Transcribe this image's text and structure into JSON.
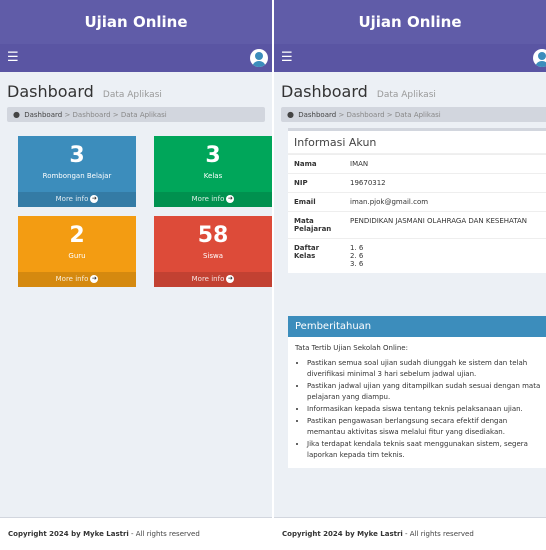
{
  "app": {
    "title": "Ujian Online"
  },
  "header": {
    "menu_icon": "hamburger-icon",
    "avatar_icon": "user-circle-icon"
  },
  "page": {
    "title": "Dashboard",
    "subtitle": "Data Aplikasi"
  },
  "breadcrumb": {
    "home_icon": "dashboard-icon",
    "items": [
      "Dashboard",
      "Dashboard",
      "Data Aplikasi"
    ],
    "separator": ">"
  },
  "stats": [
    {
      "value": "3",
      "label": "Rombongan Belajar",
      "more": "More info",
      "color": "#3c8dbc"
    },
    {
      "value": "3",
      "label": "Kelas",
      "more": "More info",
      "color": "#00a65a"
    },
    {
      "value": "2",
      "label": "Guru",
      "more": "More info",
      "color": "#f39c12"
    },
    {
      "value": "58",
      "label": "Siswa",
      "more": "More info",
      "color": "#dd4b39"
    }
  ],
  "account": {
    "title": "Informasi Akun",
    "rows": [
      {
        "label": "Nama",
        "value": "IMAN"
      },
      {
        "label": "NIP",
        "value": "19670312"
      },
      {
        "label": "Email",
        "value": "iman.pjok@gmail.com"
      },
      {
        "label": "Mata Pelajaran",
        "value": "PENDIDIKAN JASMANI OLAHRAGA DAN KESEHATAN"
      },
      {
        "label": "Daftar Kelas",
        "value": "1. 6\n2. 6\n3. 6"
      }
    ]
  },
  "notice": {
    "title": "Pemberitahuan",
    "intro": "Tata Tertib Ujian Sekolah Online:",
    "items": [
      "Pastikan semua soal ujian sudah diunggah ke sistem dan telah diverifikasi minimal 3 hari sebelum jadwal ujian.",
      "Pastikan jadwal ujian yang ditampilkan sudah sesuai dengan mata pelajaran yang diampu.",
      "Informasikan kepada siswa tentang teknis pelaksanaan ujian.",
      "Pastikan pengawasan berlangsung secara efektif dengan memantau aktivitas siswa melalui fitur yang disediakan.",
      "Jika terdapat kendala teknis saat menggunakan sistem, segera laporkan kepada tim teknis."
    ]
  },
  "footer": {
    "copyright": "Copyright 2024 by Myke Lastri",
    "rights": " - All rights reserved"
  }
}
